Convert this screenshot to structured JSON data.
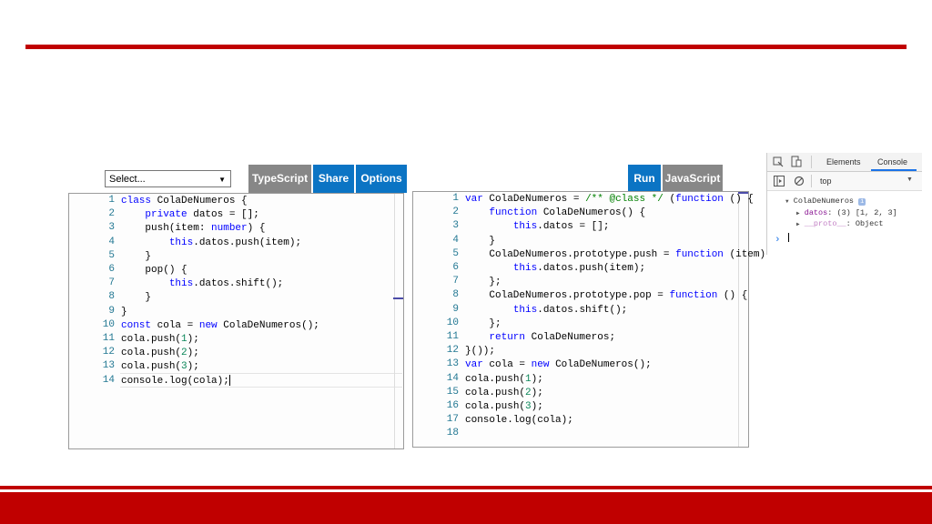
{
  "toolbar_left": {
    "select_value": "Select...",
    "typescript_label": "TypeScript",
    "share_label": "Share",
    "options_label": "Options"
  },
  "toolbar_right": {
    "run_label": "Run",
    "javascript_label": "JavaScript"
  },
  "ts_editor": {
    "line_numbers": [
      "1",
      "2",
      "3",
      "4",
      "5",
      "6",
      "7",
      "8",
      "9",
      "10",
      "11",
      "12",
      "13",
      "14"
    ],
    "lines": [
      "class ColaDeNumeros {",
      "    private datos = [];",
      "    push(item: number) {",
      "        this.datos.push(item);",
      "    }",
      "    pop() {",
      "        this.datos.shift();",
      "    }",
      "}",
      "const cola = new ColaDeNumeros();",
      "cola.push(1);",
      "cola.push(2);",
      "cola.push(3);",
      "console.log(cola);"
    ]
  },
  "js_editor": {
    "line_numbers": [
      "1",
      "2",
      "3",
      "4",
      "5",
      "6",
      "7",
      "8",
      "9",
      "10",
      "11",
      "12",
      "13",
      "14",
      "15",
      "16",
      "17",
      "18"
    ],
    "lines": [
      "var ColaDeNumeros = /** @class */ (function () {",
      "    function ColaDeNumeros() {",
      "        this.datos = [];",
      "    }",
      "    ColaDeNumeros.prototype.push = function (item)",
      "        this.datos.push(item);",
      "    };",
      "    ColaDeNumeros.prototype.pop = function () {",
      "        this.datos.shift();",
      "    };",
      "    return ColaDeNumeros;",
      "}());",
      "var cola = new ColaDeNumeros();",
      "cola.push(1);",
      "cola.push(2);",
      "cola.push(3);",
      "console.log(cola);",
      ""
    ]
  },
  "devtools": {
    "tab_elements": "Elements",
    "tab_console": "Console",
    "context": "top",
    "object_name": "ColaDeNumeros",
    "info_badge": "i",
    "prop1_key": "datos",
    "prop1_value": "(3) [1, 2, 3]",
    "prop2_key": "__proto__",
    "prop2_value": "Object",
    "prompt": "›"
  },
  "colors": {
    "accent_red": "#c00000",
    "button_blue": "#0b74c4",
    "button_gray": "#878787",
    "keyword": "#0000ff",
    "number": "#098658",
    "comment": "#008000",
    "line_number": "#237893"
  }
}
